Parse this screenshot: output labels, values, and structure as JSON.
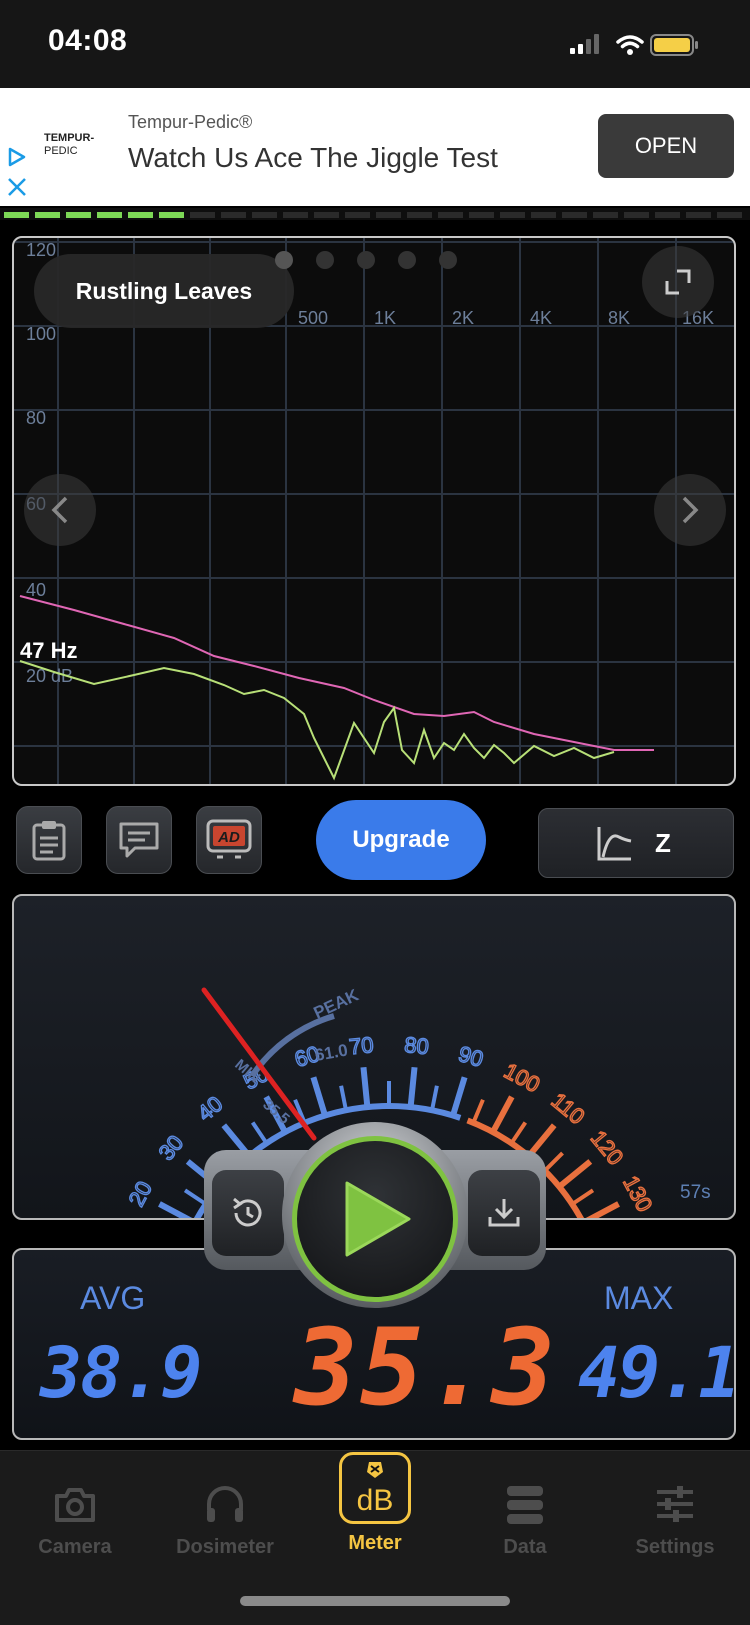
{
  "status_bar": {
    "time": "04:08"
  },
  "ad": {
    "logo_line1": "TEMPUR-",
    "logo_line2": "PEDIC",
    "brand": "Tempur-Pedic®",
    "headline": "Watch Us Ace The Jiggle Test",
    "open_label": "OPEN"
  },
  "spectrum": {
    "preset_label": "Rustling Leaves",
    "freq_readout": "47 Hz",
    "y_ticks": [
      "120",
      "100",
      "80",
      "60",
      "40",
      "20 dB"
    ],
    "x_ticks": [
      "500",
      "1K",
      "2K",
      "4K",
      "8K",
      "16K"
    ],
    "page_dots": 5,
    "active_dot": 0
  },
  "toolbar": {
    "ad_badge": "AD",
    "upgrade_label": "Upgrade",
    "weighting_label": "Z"
  },
  "meter": {
    "scale_blue": [
      "20",
      "30",
      "40",
      "50",
      "60",
      "70",
      "80",
      "90"
    ],
    "scale_orange": [
      "100",
      "110",
      "120",
      "130"
    ],
    "peak_label": "PEAK",
    "peak_value": "61.0",
    "min_label": "MIN",
    "min_value": "35.5",
    "elapsed": "57s",
    "needle_value": 35.3
  },
  "readout": {
    "avg_label": "AVG",
    "avg_value": "38.9",
    "current_value": "35.3",
    "max_label": "MAX",
    "max_value": "49.1"
  },
  "tabs": [
    {
      "label": "Camera",
      "icon": "camera-icon",
      "active": false
    },
    {
      "label": "Dosimeter",
      "icon": "headphones-icon",
      "active": false
    },
    {
      "label": "Meter",
      "icon": "db-meter-icon",
      "active": true
    },
    {
      "label": "Data",
      "icon": "database-icon",
      "active": false
    },
    {
      "label": "Settings",
      "icon": "sliders-icon",
      "active": false
    }
  ],
  "colors": {
    "accent_blue": "#3a7bea",
    "active_tab": "#f5c542",
    "meter_blue": "#5b8ae0",
    "meter_orange": "#e8703e",
    "curve_pink": "#e067b5",
    "curve_green": "#b8e078",
    "play_green": "#7fc241"
  }
}
